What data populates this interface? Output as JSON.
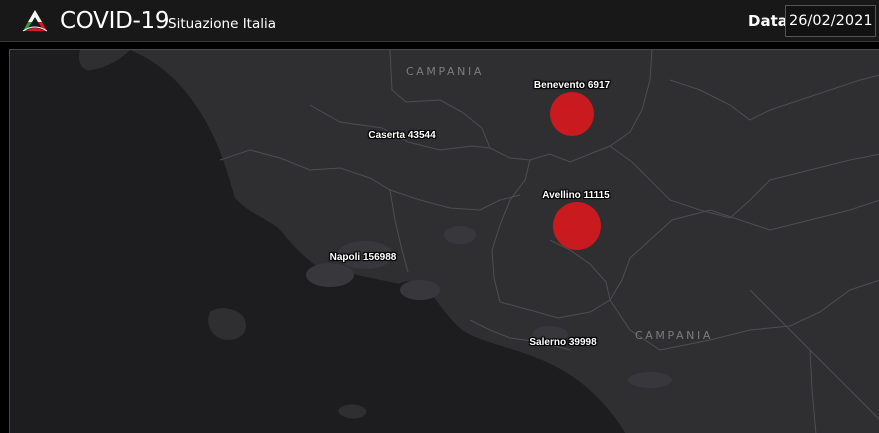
{
  "header": {
    "app_title": "COVID-19",
    "app_subtitle": "Situazione Italia",
    "date_label": "Data",
    "date_value": "26/02/2021",
    "logo_icon": "protezione-civile-logo-icon"
  },
  "map": {
    "region_labels": [
      "CAMPANIA",
      "CAMPANIA"
    ],
    "colors": {
      "sea": "#1d1d20",
      "land": "#2f2f32",
      "marker": "#c91a1f"
    },
    "provinces": [
      {
        "name": "Benevento",
        "cases": 6917,
        "label": "Benevento 6917",
        "marker": true
      },
      {
        "name": "Caserta",
        "cases": 43544,
        "label": "Caserta 43544",
        "marker": false
      },
      {
        "name": "Avellino",
        "cases": 11115,
        "label": "Avellino 11115",
        "marker": true
      },
      {
        "name": "Napoli",
        "cases": 156988,
        "label": "Napoli 156988",
        "marker": false
      },
      {
        "name": "Salerno",
        "cases": 39998,
        "label": "Salerno 39998",
        "marker": false
      }
    ]
  }
}
